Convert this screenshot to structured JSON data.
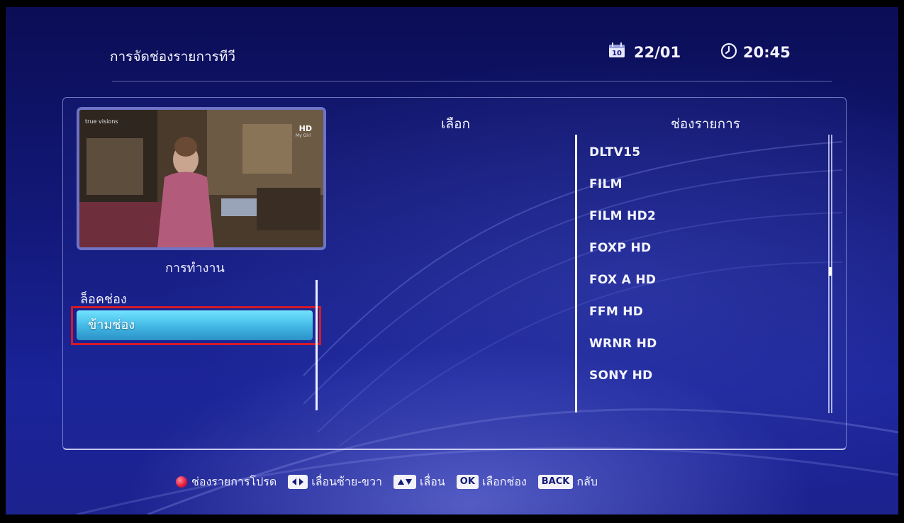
{
  "header": {
    "title": "การจัดช่องรายการทีวี",
    "calendar_icon_day": "10",
    "date": "22/01",
    "time": "20:45"
  },
  "preview": {
    "channel_logo": "true visions",
    "hd_badge": "HD",
    "program": "My Girl"
  },
  "operations": {
    "heading": "การทำงาน",
    "items": [
      {
        "label": "ล็อคช่อง",
        "selected": false
      },
      {
        "label": "ข้ามช่อง",
        "selected": true
      }
    ]
  },
  "select_column": {
    "heading": "เลือก"
  },
  "channels": {
    "heading": "ช่องรายการ",
    "items": [
      "DLTV15",
      "FILM",
      "FILM HD2",
      "FOXP HD",
      "FOX A HD",
      "FFM HD",
      "WRNR HD",
      "SONY HD"
    ]
  },
  "footer": {
    "favorite_label": "ช่องรายการโปรด",
    "left_right_label": "เลื่อนซ้าย-ขวา",
    "up_down_label": "เลื่อน",
    "ok_key": "OK",
    "ok_label": "เลือกช่อง",
    "back_key": "BACK",
    "back_label": "กลับ"
  },
  "colors": {
    "background": "#121877",
    "highlight": "#44b9e6",
    "selection_outline": "#d6192a"
  }
}
